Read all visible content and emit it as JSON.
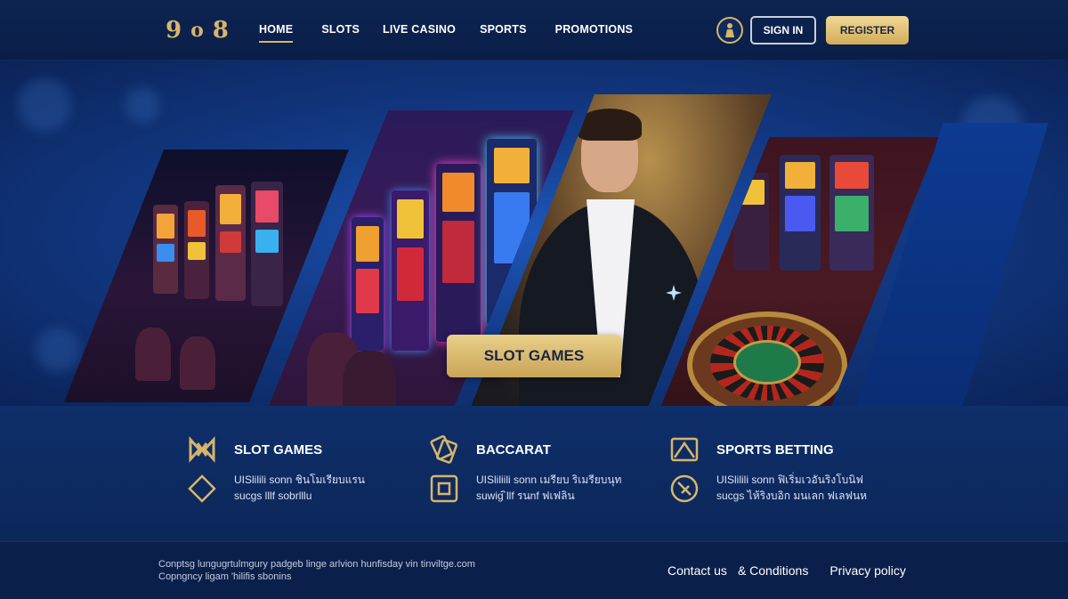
{
  "header": {
    "logo": {
      "part1": "9",
      "part2": "o",
      "part3": "8"
    },
    "nav": [
      {
        "label": "HOME",
        "active": true
      },
      {
        "label": "SLOTS",
        "active": false
      },
      {
        "label": "LIVE CASINO",
        "active": false
      },
      {
        "label": "SPORTS",
        "active": false
      },
      {
        "label": "PROMOTIONS",
        "active": false
      }
    ],
    "user_icon": "user-icon",
    "sign_in_label": "SIGN IN",
    "register_label": "REGISTER"
  },
  "hero": {
    "cta_label": "SLOT GAMES"
  },
  "features": [
    {
      "title": "SLOT GAMES",
      "desc_line1": "UISlilili sonn ชินโมเรียบแรน",
      "desc_line2": "sucgs lllf sobrlllu",
      "icon_top": "slot-logo-icon",
      "icon_bottom": "diamond-icon"
    },
    {
      "title": "BACCARAT",
      "desc_line1": "UISliliili sonn เมรียบ ริเมรียบนุท",
      "desc_line2": "suwig ิllf รนnf ฟเฟลิน",
      "icon_top": "cards-icon",
      "icon_bottom": "table-icon"
    },
    {
      "title": "SPORTS BETTING",
      "desc_line1": "UISlilili sonn ฟิเริ่มเวอันริงโบนิฟ",
      "desc_line2": "sucgs ไห้ริงบอิก มนเลก ฟเลฟนห",
      "icon_top": "field-icon",
      "icon_bottom": "ball-icon"
    }
  ],
  "footer": {
    "copyright_line1": "Conptsg lungugrtulmgury padgeb linge arlvion hunfisday vin tinviltge.com",
    "copyright_line2": "Copngncy ligam 'hilifis sbonins",
    "links": [
      "Contact us",
      "& Conditions",
      "Privacy policy"
    ]
  },
  "colors": {
    "gold": "#d8b56a",
    "navy": "#0b2150",
    "hero_blue": "#1d56b8"
  }
}
